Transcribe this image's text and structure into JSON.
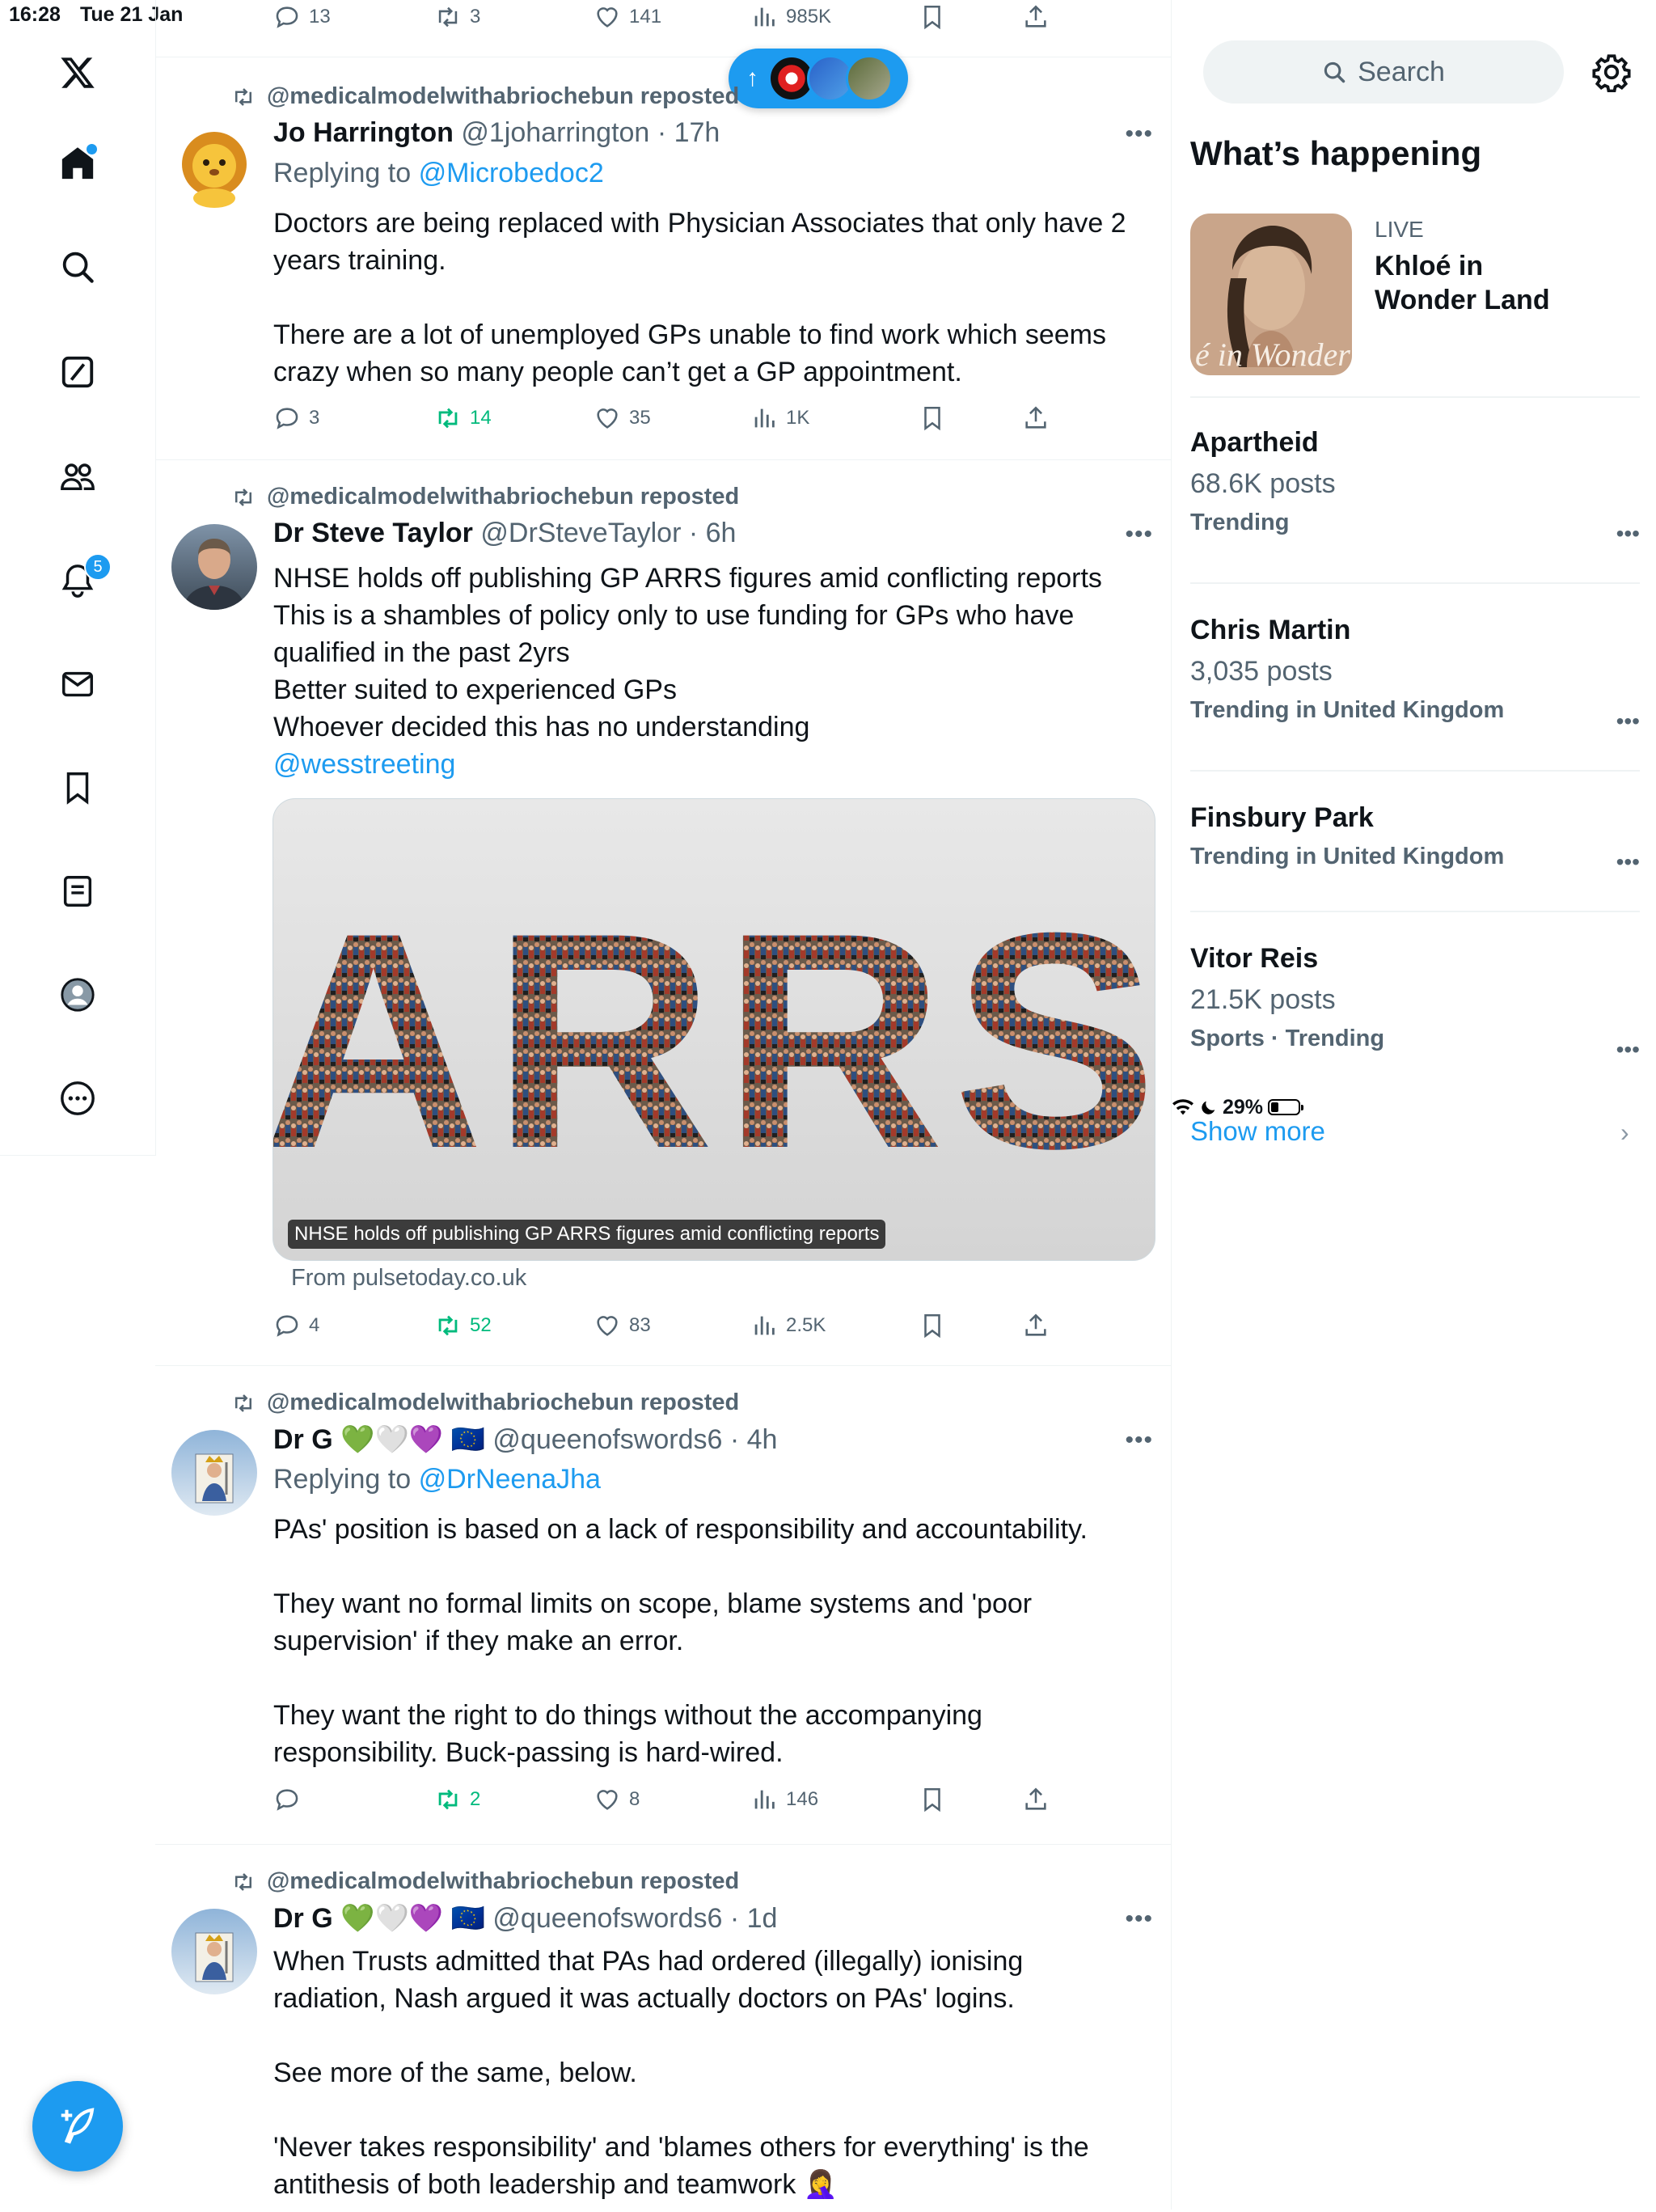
{
  "status_bar": {
    "time": "16:28",
    "date": "Tue 21 Jan",
    "battery": "29%",
    "battery_fraction": 0.29
  },
  "nav": {
    "notifications_badge": "5",
    "icons": [
      "x-logo",
      "home-icon",
      "search-icon",
      "grok-icon",
      "communities-icon",
      "notifications-icon",
      "messages-icon",
      "bookmarks-icon",
      "lists-icon",
      "profile-icon",
      "more-icon",
      "compose-icon"
    ]
  },
  "top_tweet_actions": {
    "replies": "13",
    "reposts": "3",
    "likes": "141",
    "views": "985K"
  },
  "new_posts_pill": {
    "label": "↑"
  },
  "tweets": [
    {
      "repost_label": "@medicalmodelwithabriochebun reposted",
      "name": "Jo Harrington",
      "handle": "@1joharrington",
      "time": "· 17h",
      "replying_prefix": "Replying to",
      "replying_to": "@Microbedoc2",
      "text": "Doctors are being replaced with Physician Associates that only have 2 years training.\n\nThere are a lot of unemployed GPs unable to find work which seems crazy when so many people can’t get a GP appointment.",
      "replies": "3",
      "reposts": "14",
      "likes": "35",
      "views": "1K"
    },
    {
      "repost_label": "@medicalmodelwithabriochebun reposted",
      "name": "Dr Steve Taylor",
      "handle": "@DrSteveTaylor",
      "time": "· 6h",
      "text": "NHSE holds off publishing GP ARRS figures amid conflicting reports\nThis is a shambles of policy only to use funding for GPs who have qualified in the past 2yrs\nBetter suited to experienced GPs\nWhoever decided this has no understanding",
      "mention": "@wesstreeting",
      "card_text": "ARRS",
      "card_caption": "NHSE holds off publishing GP ARRS figures amid conflicting reports",
      "card_source": "From pulsetoday.co.uk",
      "replies": "4",
      "reposts": "52",
      "likes": "83",
      "views": "2.5K"
    },
    {
      "repost_label": "@medicalmodelwithabriochebun reposted",
      "name": "Dr G",
      "emojis": "💚🤍💜 🇪🇺",
      "handle": "@queenofswords6",
      "time": "· 4h",
      "replying_prefix": "Replying to",
      "replying_to": "@DrNeenaJha",
      "text": "PAs' position is based on a lack of responsibility and accountability.\n\nThey want no formal limits on scope, blame systems and 'poor supervision' if they make an error.\n\nThey want the right to do things without the accompanying responsibility. Buck-passing is hard-wired.",
      "replies": "",
      "reposts": "2",
      "likes": "8",
      "views": "146"
    },
    {
      "repost_label": "@medicalmodelwithabriochebun reposted",
      "name": "Dr G",
      "emojis": "💚🤍💜 🇪🇺",
      "handle": "@queenofswords6",
      "time": "· 1d",
      "text": "When Trusts admitted that PAs had ordered (illegally) ionising radiation, Nash argued it was actually doctors on PAs' logins.\n\nSee more of the same, below.\n\n'Never takes responsibility' and 'blames others for everything' is the antithesis of both leadership and teamwork 🤦‍♀️"
    }
  ],
  "sidebar": {
    "search_placeholder": "Search",
    "title": "What’s happening",
    "live": {
      "label": "LIVE",
      "title": "Khloé in Wonder Land",
      "image_text": "é in Wonder l"
    },
    "trends": [
      {
        "name": "Apartheid",
        "count": "68.6K posts",
        "meta": "Trending"
      },
      {
        "name": "Chris Martin",
        "count": "3,035 posts",
        "meta": "Trending in United Kingdom"
      },
      {
        "name": "Finsbury Park",
        "count": "",
        "meta": "Trending in United Kingdom"
      },
      {
        "name": "Vitor Reis",
        "count": "21.5K posts",
        "meta": "Sports · Trending"
      }
    ],
    "show_more": "Show more"
  },
  "colors": {
    "accent": "#1d9bf0",
    "repost_green": "#00ba7c",
    "secondary_text": "#536471",
    "border": "#eff3f4"
  }
}
